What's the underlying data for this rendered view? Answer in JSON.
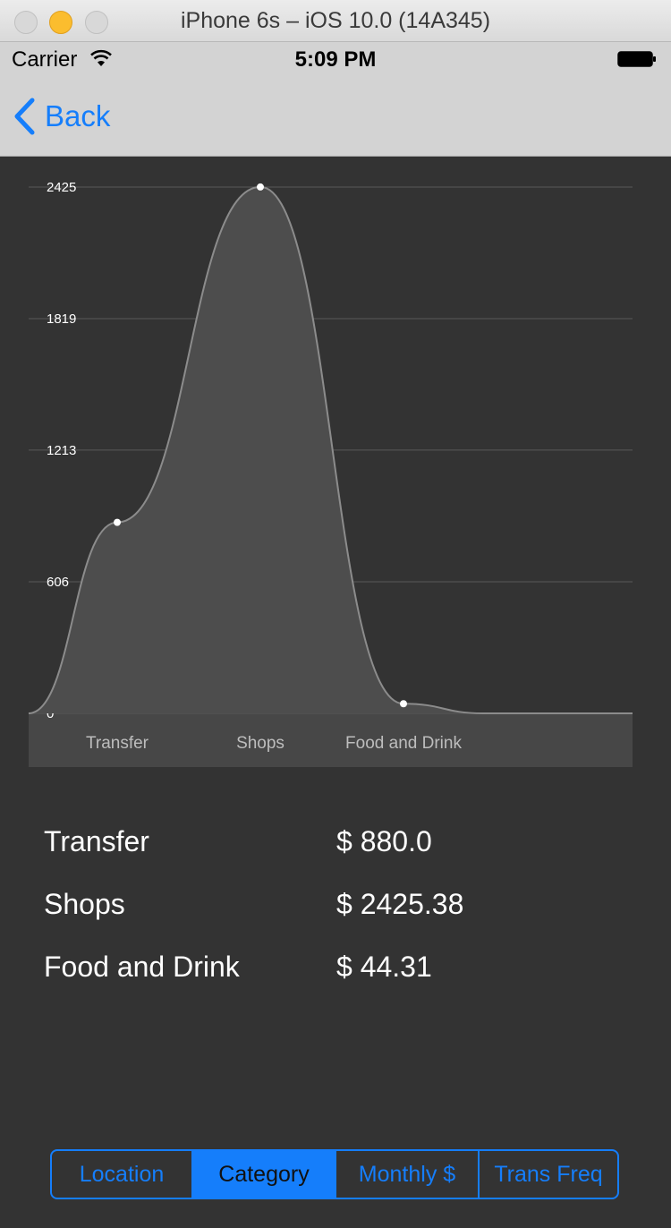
{
  "window": {
    "title": "iPhone 6s – iOS 10.0 (14A345)"
  },
  "status_bar": {
    "carrier": "Carrier",
    "time": "5:09 PM"
  },
  "nav": {
    "back_label": "Back"
  },
  "chart_data": {
    "type": "area",
    "categories": [
      "Transfer",
      "Shops",
      "Food and Drink"
    ],
    "values": [
      880.0,
      2425.38,
      44.31
    ],
    "y_ticks": [
      "2425",
      "1819",
      "1213",
      "606",
      "0"
    ],
    "ylim": [
      0,
      2425
    ],
    "grid": true,
    "colors": {
      "fill": "#4d4d4d",
      "line": "#8c8c8c",
      "point": "#ffffff"
    }
  },
  "categories_table": [
    {
      "name": "Transfer",
      "amount": "$ 880.0"
    },
    {
      "name": "Shops",
      "amount": "$ 2425.38"
    },
    {
      "name": "Food and Drink",
      "amount": "$ 44.31"
    }
  ],
  "segments": [
    {
      "label": "Location",
      "active": false
    },
    {
      "label": "Category",
      "active": true
    },
    {
      "label": "Monthly $",
      "active": false
    },
    {
      "label": "Trans Freq",
      "active": false
    }
  ],
  "accent_color": "#157efb"
}
